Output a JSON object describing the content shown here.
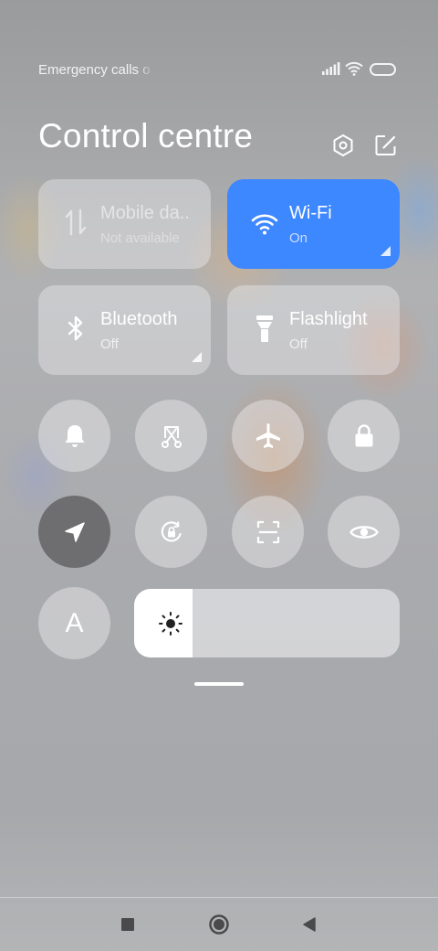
{
  "status_bar": {
    "carrier_text": "Emergency calls o",
    "signal_icon": "signal-bars-icon",
    "wifi_icon": "wifi-icon",
    "battery_icon": "battery-icon"
  },
  "header": {
    "title": "Control centre",
    "settings_icon": "settings-hexagon-icon",
    "edit_icon": "edit-icon"
  },
  "tiles": [
    {
      "id": "mobile-data",
      "label": "Mobile da..",
      "sub": "Not available",
      "icon": "mobile-data-icon",
      "active": false,
      "dimmed": true
    },
    {
      "id": "wifi",
      "label": "Wi-Fi",
      "sub": "On",
      "icon": "wifi-icon",
      "active": true
    },
    {
      "id": "bluetooth",
      "label": "Bluetooth",
      "sub": "Off",
      "icon": "bluetooth-icon",
      "active": false
    },
    {
      "id": "flashlight",
      "label": "Flashlight",
      "sub": "Off",
      "icon": "flashlight-icon",
      "active": false
    }
  ],
  "toggles_row1": [
    {
      "id": "silent",
      "icon": "bell-icon"
    },
    {
      "id": "screenshot",
      "icon": "scissors-screenshot-icon"
    },
    {
      "id": "airplane",
      "icon": "airplane-icon"
    },
    {
      "id": "lock",
      "icon": "lock-icon"
    }
  ],
  "toggles_row2": [
    {
      "id": "location",
      "icon": "location-arrow-icon",
      "active": true
    },
    {
      "id": "rotation-lock",
      "icon": "rotation-lock-icon"
    },
    {
      "id": "scanner",
      "icon": "scanner-icon"
    },
    {
      "id": "reading-mode",
      "icon": "eye-icon"
    }
  ],
  "auto_brightness": {
    "label": "A"
  },
  "brightness": {
    "level": 0.22,
    "icon": "sun-icon"
  },
  "navigation": {
    "recents_icon": "square-icon",
    "home_icon": "circle-icon",
    "back_icon": "triangle-back-icon"
  },
  "colors": {
    "accent": "#3d87ff",
    "active_toggle": "#6e6e70"
  }
}
